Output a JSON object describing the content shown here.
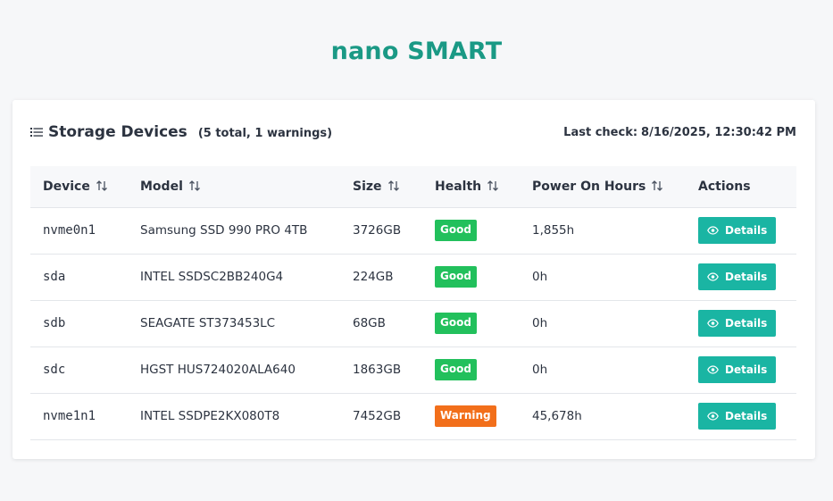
{
  "app": {
    "title": "nano SMART"
  },
  "card": {
    "title": "Storage Devices",
    "subtitle": "(5 total, 1 warnings)",
    "last_check_label": "Last check:",
    "last_check_value": "8/16/2025, 12:30:42 PM",
    "icon": "list-icon"
  },
  "table": {
    "columns": [
      {
        "label": "Device",
        "sortable": true
      },
      {
        "label": "Model",
        "sortable": true
      },
      {
        "label": "Size",
        "sortable": true
      },
      {
        "label": "Health",
        "sortable": true
      },
      {
        "label": "Power On Hours",
        "sortable": true
      },
      {
        "label": "Actions",
        "sortable": false
      }
    ],
    "rows": [
      {
        "device": "nvme0n1",
        "model": "Samsung SSD 990 PRO 4TB",
        "size": "3726GB",
        "health": "Good",
        "hours": "1,855h",
        "action": "Details"
      },
      {
        "device": "sda",
        "model": "INTEL SSDSC2BB240G4",
        "size": "224GB",
        "health": "Good",
        "hours": "0h",
        "action": "Details"
      },
      {
        "device": "sdb",
        "model": "SEAGATE ST373453LC",
        "size": "68GB",
        "health": "Good",
        "hours": "0h",
        "action": "Details"
      },
      {
        "device": "sdc",
        "model": "HGST HUS724020ALA640",
        "size": "1863GB",
        "health": "Good",
        "hours": "0h",
        "action": "Details"
      },
      {
        "device": "nvme1n1",
        "model": "INTEL SSDPE2KX080T8",
        "size": "7452GB",
        "health": "Warning",
        "hours": "45,678h",
        "action": "Details"
      }
    ]
  },
  "colors": {
    "accent": "#1a9985",
    "button": "#1ab5a3",
    "good": "#22c05c",
    "warning": "#f26f1b"
  }
}
